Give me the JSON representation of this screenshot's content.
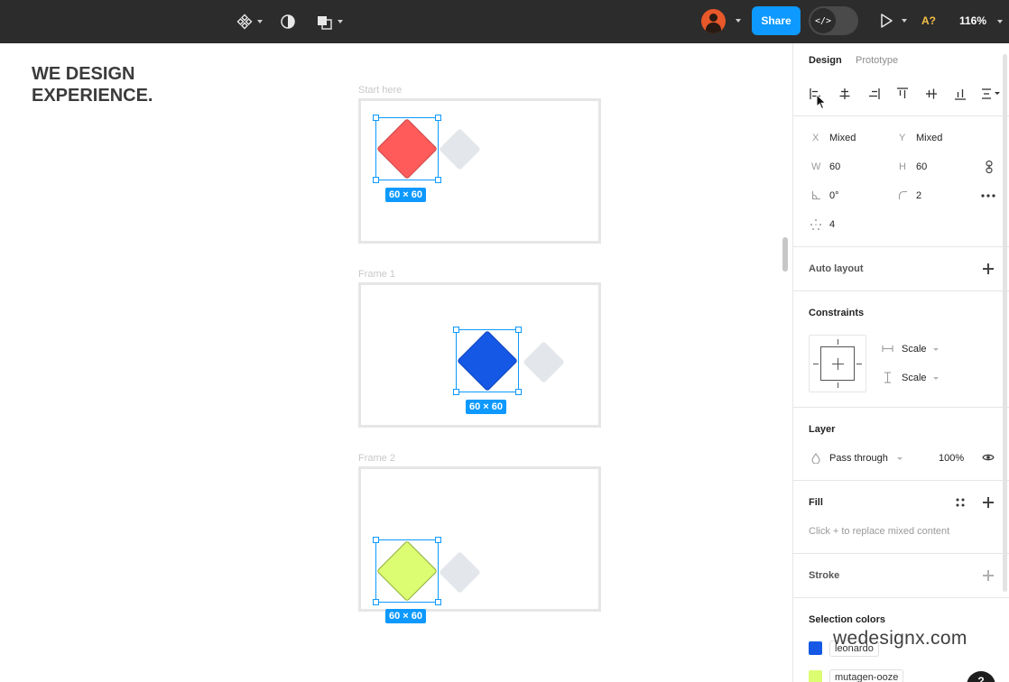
{
  "toolbar": {
    "components_icon": "component-icon",
    "theme_icon": "contrast-icon",
    "shapes_icon": "overlap-shapes-icon",
    "share_label": "Share",
    "dev_mode_glyph": "</>",
    "present_icon": "play-icon",
    "accessibility_label": "A?",
    "zoom_label": "116%"
  },
  "canvas": {
    "brand_line1": "WE DESIGN",
    "brand_line2": "EXPERIENCE.",
    "frames": [
      {
        "label": "Start here",
        "shape_color": "#ff5b5b",
        "size_label": "60 × 60"
      },
      {
        "label": "Frame 1",
        "shape_color": "#1558e6",
        "size_label": "60 × 60"
      },
      {
        "label": "Frame 2",
        "shape_color": "#dcfc72",
        "size_label": "60 × 60"
      }
    ]
  },
  "panel": {
    "tabs": {
      "design": "Design",
      "prototype": "Prototype"
    },
    "position": {
      "x_label": "X",
      "x_value": "Mixed",
      "y_label": "Y",
      "y_value": "Mixed",
      "w_label": "W",
      "w_value": "60",
      "h_label": "H",
      "h_value": "60",
      "rotation_value": "0°",
      "radius_value": "2",
      "points_value": "4"
    },
    "auto_layout": "Auto layout",
    "constraints": {
      "title": "Constraints",
      "horizontal": "Scale",
      "vertical": "Scale"
    },
    "layer": {
      "title": "Layer",
      "blend_mode": "Pass through",
      "opacity": "100%"
    },
    "fill": {
      "title": "Fill",
      "hint": "Click + to replace mixed content"
    },
    "stroke": "Stroke",
    "selection_colors": {
      "title": "Selection colors",
      "items": [
        {
          "name": "leonardo",
          "color": "#1558e6"
        },
        {
          "name": "mutagen-ooze",
          "color": "#dcfc72"
        }
      ]
    }
  },
  "watermark": "wedesignx.com",
  "colors": {
    "accent": "#0d99ff",
    "toolbar_bg": "#2c2c2c"
  }
}
